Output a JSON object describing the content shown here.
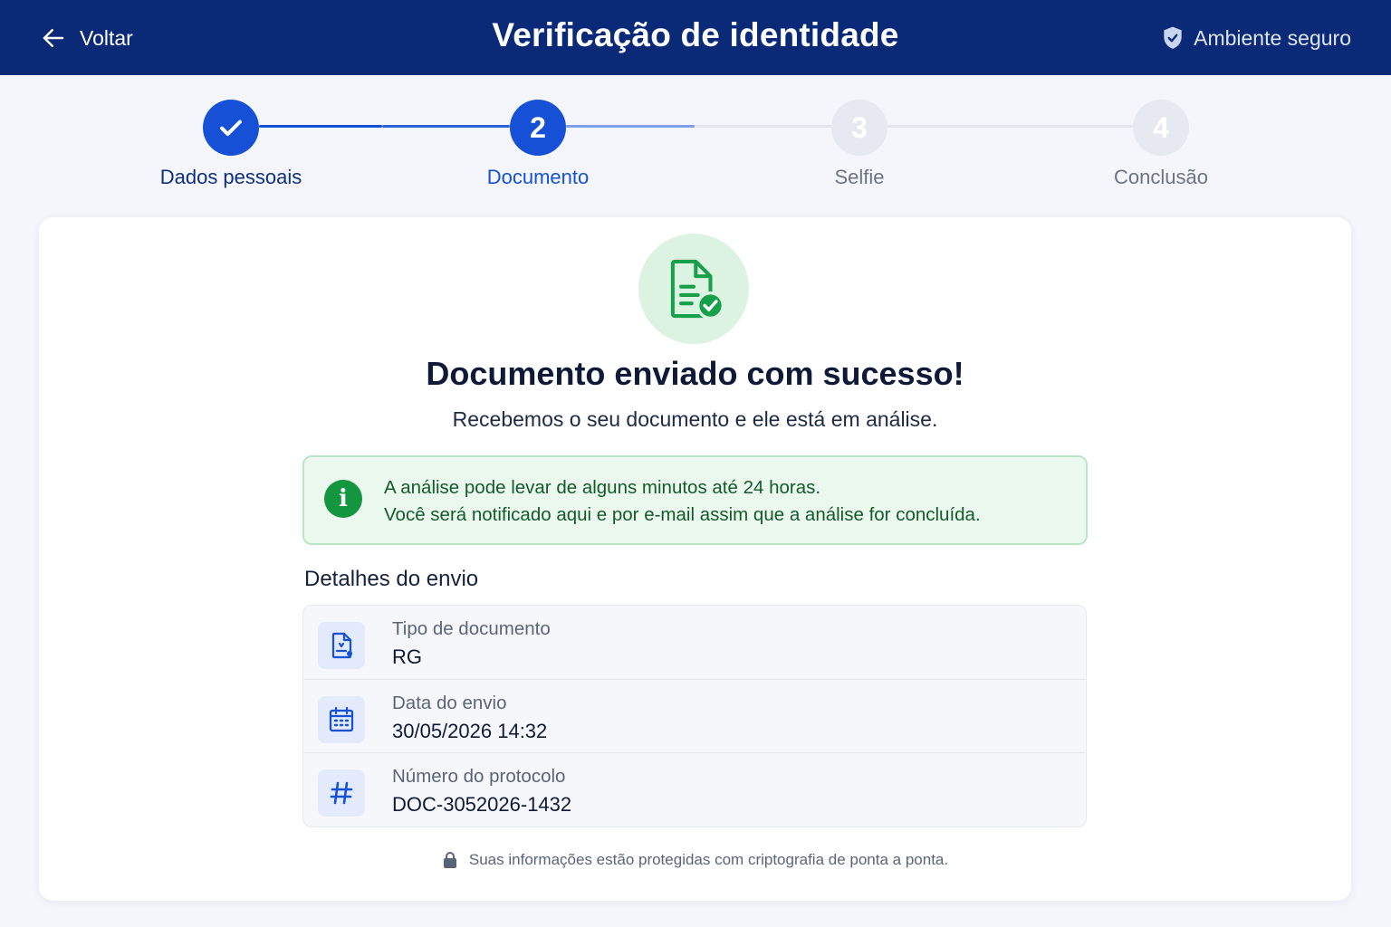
{
  "header": {
    "back_label": "Voltar",
    "title": "Verificação de identidade",
    "secure_label": "Ambiente seguro"
  },
  "stepper": {
    "steps": [
      {
        "label": "Dados pessoais",
        "number": "1",
        "state": "completed"
      },
      {
        "label": "Documento",
        "number": "2",
        "state": "current"
      },
      {
        "label": "Selfie",
        "number": "3",
        "state": "upcoming"
      },
      {
        "label": "Conclusão",
        "number": "4",
        "state": "upcoming"
      }
    ]
  },
  "card": {
    "title": "Documento enviado com sucesso!",
    "subtitle": "Recebemos o seu documento e ele está em análise.",
    "info": {
      "line1": "A análise pode levar de alguns minutos até 24 horas.",
      "line2": "Você será notificado aqui e por e-mail assim que a análise for concluída."
    },
    "details_heading": "Detalhes do envio",
    "details": [
      {
        "label": "Tipo de documento",
        "value": "RG",
        "icon": "document-icon"
      },
      {
        "label": "Data do envio",
        "value": "30/05/2026 14:32",
        "icon": "calendar-icon"
      },
      {
        "label": "Número do protocolo",
        "value": "DOC-3052026-1432",
        "icon": "hash-icon"
      }
    ],
    "footer_note": "Suas informações estão protegidas com criptografia de ponta a ponta."
  },
  "colors": {
    "header_bg": "#0a2a78",
    "primary": "#1550d6",
    "success": "#14953f",
    "success_bg": "#ebf8ee"
  }
}
